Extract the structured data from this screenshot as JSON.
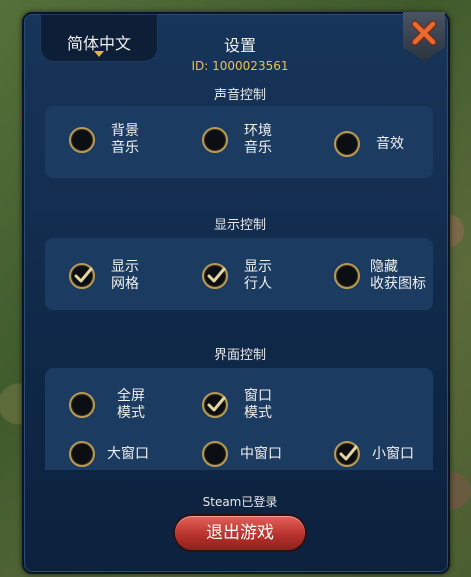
{
  "header": {
    "language": "简体中文",
    "title": "设置",
    "player_id": "ID: 1000023561"
  },
  "sections": {
    "sound": {
      "title": "声音控制",
      "options": [
        {
          "label": "背景\n音乐",
          "checked": false
        },
        {
          "label": "环境\n音乐",
          "checked": false
        },
        {
          "label": "音效",
          "checked": false
        }
      ]
    },
    "display": {
      "title": "显示控制",
      "options": [
        {
          "label": "显示\n网格",
          "checked": true
        },
        {
          "label": "显示\n行人",
          "checked": true
        },
        {
          "label": "隐藏\n收获图标",
          "checked": false
        }
      ]
    },
    "ui": {
      "title": "界面控制",
      "options": [
        {
          "label": "全屏\n模式",
          "checked": false
        },
        {
          "label": "窗口\n模式",
          "checked": true
        },
        {
          "label": "大窗口",
          "checked": false
        },
        {
          "label": "中窗口",
          "checked": false
        },
        {
          "label": "小窗口",
          "checked": true
        }
      ]
    }
  },
  "footer": {
    "steam_status": "Steam已登录",
    "exit_label": "退出游戏"
  },
  "colors": {
    "panel": "#0f2848",
    "section_box": "#1c3b60",
    "id_text": "#e7c34a",
    "check_border": "#b79a55",
    "exit_button": "#c2392f"
  }
}
